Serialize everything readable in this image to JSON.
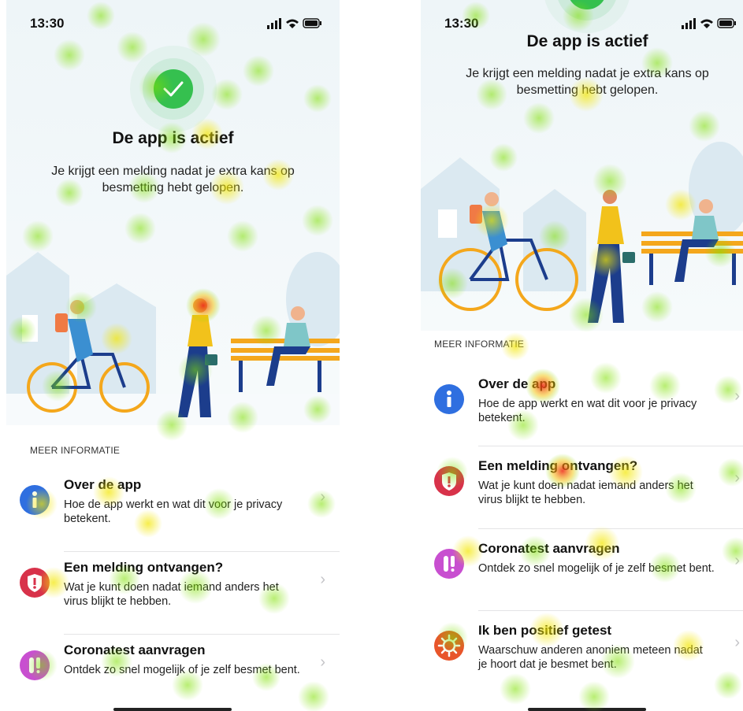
{
  "status": {
    "time": "13:30"
  },
  "hero": {
    "title": "De app is actief",
    "subtitle": "Je krijgt een melding nadat je extra kans op besmetting hebt gelopen."
  },
  "section_header": "MEER INFORMATIE",
  "items": [
    {
      "title": "Over de app",
      "desc": "Hoe de app werkt en wat dit voor je privacy betekent.",
      "icon": "info-icon",
      "color": "#2f6fe0"
    },
    {
      "title": "Een melding ontvangen?",
      "desc": "Wat je kunt doen nadat iemand anders het virus blijkt te hebben.",
      "icon": "shield-alert-icon",
      "color": "#d8324a"
    },
    {
      "title": "Coronatest aanvragen",
      "desc": "Ontdek zo snel mogelijk of je zelf besmet bent.",
      "icon": "test-tube-icon",
      "color": "#c84fd0"
    },
    {
      "title": "Ik ben positief getest",
      "desc": "Waarschuw anderen anoniem meteen nadat je hoort dat je besmet bent.",
      "icon": "virus-icon",
      "color": "#e8552a"
    }
  ],
  "colors": {
    "accent_green": "#35c04f",
    "heat_green": "#7ee000",
    "heat_yellow": "#f3e600",
    "heat_red": "#ef2a14"
  }
}
